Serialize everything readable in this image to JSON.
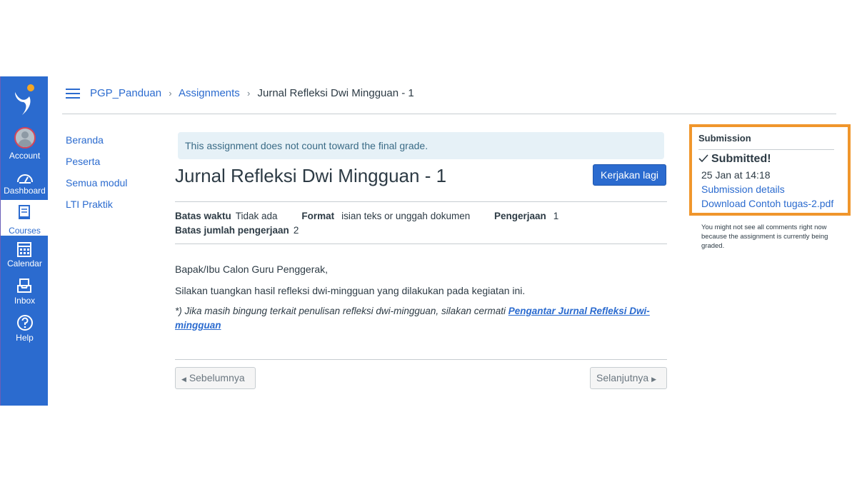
{
  "global_nav": {
    "items": [
      {
        "label": "Account",
        "icon": "avatar"
      },
      {
        "label": "Dashboard",
        "icon": "dashboard-icon"
      },
      {
        "label": "Courses",
        "icon": "courses-icon",
        "active": true
      },
      {
        "label": "Calendar",
        "icon": "calendar-icon"
      },
      {
        "label": "Inbox",
        "icon": "inbox-icon"
      },
      {
        "label": "Help",
        "icon": "help-icon"
      }
    ]
  },
  "breadcrumb": {
    "course": "PGP_Panduan",
    "section": "Assignments",
    "current": "Jurnal Refleksi Dwi Mingguan - 1"
  },
  "course_nav": {
    "items": [
      "Beranda",
      "Peserta",
      "Semua modul",
      "LTI Praktik"
    ]
  },
  "assignment": {
    "notice": "This assignment does not count toward the final grade.",
    "title": "Jurnal Refleksi Dwi Mingguan - 1",
    "retry_button": "Kerjakan lagi",
    "details": {
      "due_label": "Batas waktu",
      "due_value": "Tidak ada",
      "format_label": "Format",
      "format_value": "isian teks or unggah dokumen",
      "attempts_label": "Pengerjaan",
      "attempts_value": "1",
      "max_attempts_label": "Batas jumlah pengerjaan",
      "max_attempts_value": "2"
    },
    "body": {
      "greeting": "Bapak/Ibu Calon Guru Penggerak,",
      "instruction": "Silakan tuangkan hasil refleksi dwi-mingguan yang dilakukan pada kegiatan ini.",
      "note_prefix": "*) Jika masih bingung terkait penulisan refleksi dwi-mingguan, silakan cermati ",
      "note_link": "Pengantar Jurnal Refleksi Dwi-mingguan"
    },
    "pager": {
      "prev": "Sebelumnya",
      "next": "Selanjutnya"
    }
  },
  "submission": {
    "heading": "Submission",
    "status": "Submitted!",
    "date": "25 Jan at 14:18",
    "details_link": "Submission details",
    "download_link": "Download Contoh tugas-2.pdf",
    "note": "You might not see all comments right now because the assignment is currently being graded."
  },
  "colors": {
    "brand_blue": "#2b6bcf",
    "highlight_orange": "#f0962c",
    "notice_bg": "#e6f1f7"
  }
}
